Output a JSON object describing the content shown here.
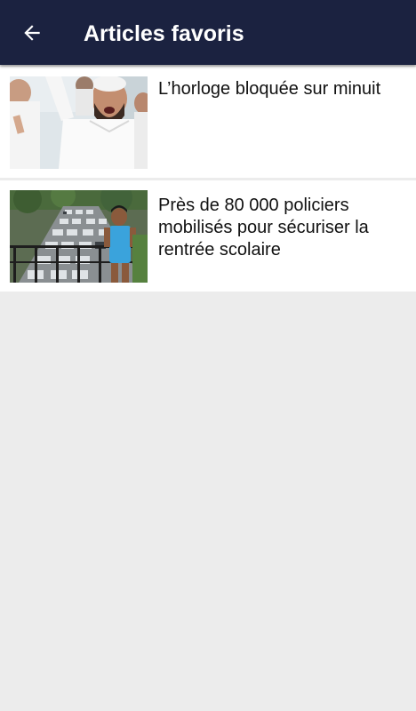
{
  "app_bar": {
    "title": "Articles favoris",
    "back_icon": "arrow-left-icon",
    "background": "#1b2240"
  },
  "articles": [
    {
      "title": "L’horloge bloquée sur minuit",
      "thumbnail": "photo-crowd-protest"
    },
    {
      "title": "Près de 80 000 policiers mobilisés pour sécuriser la rentrée scolaire",
      "thumbnail": "photo-traffic-jam-boy"
    }
  ]
}
